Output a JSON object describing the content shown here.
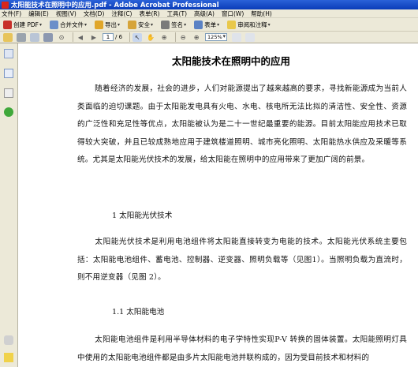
{
  "window": {
    "title": "太阳能技术在照明中的应用.pdf - Adobe Acrobat Professional"
  },
  "menu": [
    "文件(F)",
    "编辑(E)",
    "视图(V)",
    "文档(D)",
    "注释(C)",
    "表单(R)",
    "工具(T)",
    "高级(A)",
    "窗口(W)",
    "帮助(H)"
  ],
  "toolbar1": {
    "create_pdf": "创建 PDF",
    "combine": "合并文件",
    "export": "导出",
    "secure": "安全",
    "sign": "签名",
    "forms": "表单",
    "review": "审阅和注释"
  },
  "toolbar2": {
    "page_current": "1",
    "page_total": "/ 6",
    "zoom": "125%"
  },
  "document": {
    "title": "太阳能技术在照明中的应用",
    "para1": "随着经济的发展，社会的进步，人们对能源提出了越来越高的要求，寻找新能源成为当前人类面临的迫切课题。由于太阳能发电具有火电、水电、核电所无法比拟的清洁性、安全性、资源的广泛性和充足性等优点，太阳能被认为是二十一世纪最重要的能源。目前太阳能应用技术已取得较大突破，并且已较成熟地应用于建筑楼道照明、城市亮化照明、太阳能热水供应及采暖等系统。尤其是太阳能光伏技术的发展，给太阳能在照明中的应用带来了更加广阔的前景。",
    "section1": "1 太阳能光伏技术",
    "para2": "太阳能光伏技术是利用电池组件将太阳能直接转变为电能的技术。太阳能光伏系统主要包括：太阳能电池组件、蓄电池、控制器、逆变器、照明负载等（见图1）。当照明负载为直流时，则不用逆变器（见图 2）。",
    "section2": "1.1 太阳能电池",
    "para3": "太阳能电池组件是利用半导体材料的电子学特性实现P-V 转换的固体装置。太阳能照明灯具中使用的太阳能电池组件都是由多片太阳能电池并联构成的，因为受目前技术和材料的"
  },
  "colors": {
    "titlebar": "#0a3cb8",
    "chrome": "#ece9d8",
    "page": "#ffffff"
  }
}
